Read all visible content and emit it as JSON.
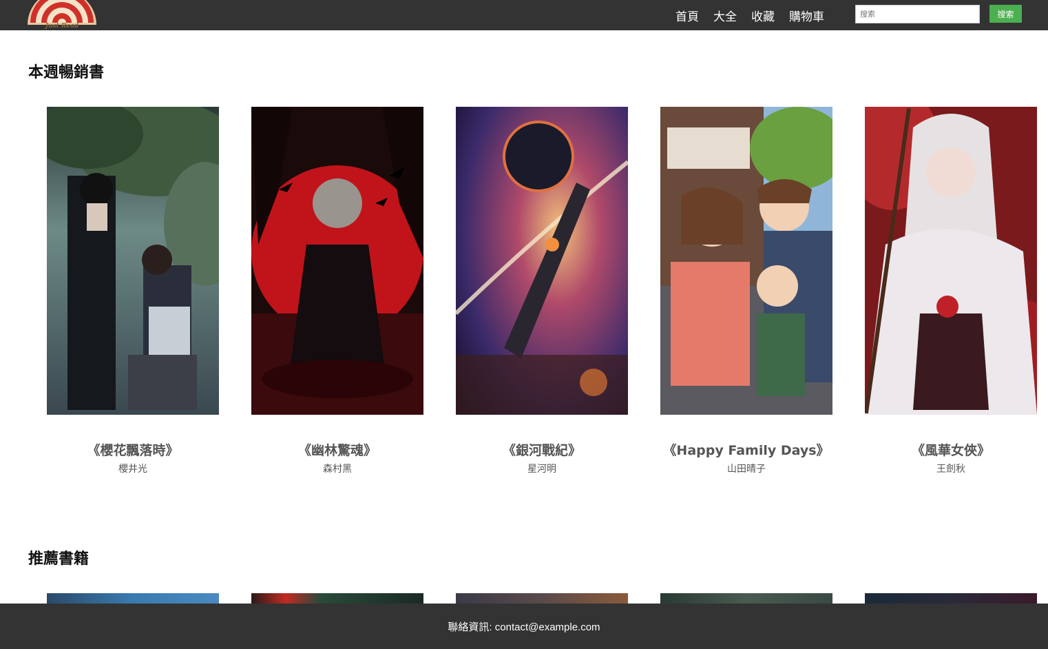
{
  "header": {
    "logo_text": "Just Read",
    "nav": [
      "首頁",
      "大全",
      "收藏",
      "購物車"
    ],
    "search_placeholder": "搜索",
    "search_button": "搜索"
  },
  "bestsellers": {
    "title": "本週暢銷書",
    "books": [
      {
        "title": "《櫻花飄落時》",
        "author": "櫻井光"
      },
      {
        "title": "《幽林驚魂》",
        "author": "森村黑"
      },
      {
        "title": "《銀河戰紀》",
        "author": "星河明"
      },
      {
        "title": "《Happy Family Days》",
        "author": "山田晴子"
      },
      {
        "title": "《風華女俠》",
        "author": "王劍秋"
      }
    ]
  },
  "recommended": {
    "title": "推薦書籍"
  },
  "footer": {
    "contact": "聯絡資訊: contact@example.com"
  },
  "colors": {
    "header_bg": "#333333",
    "accent_green": "#4caf50",
    "footer_bg": "#333333"
  }
}
